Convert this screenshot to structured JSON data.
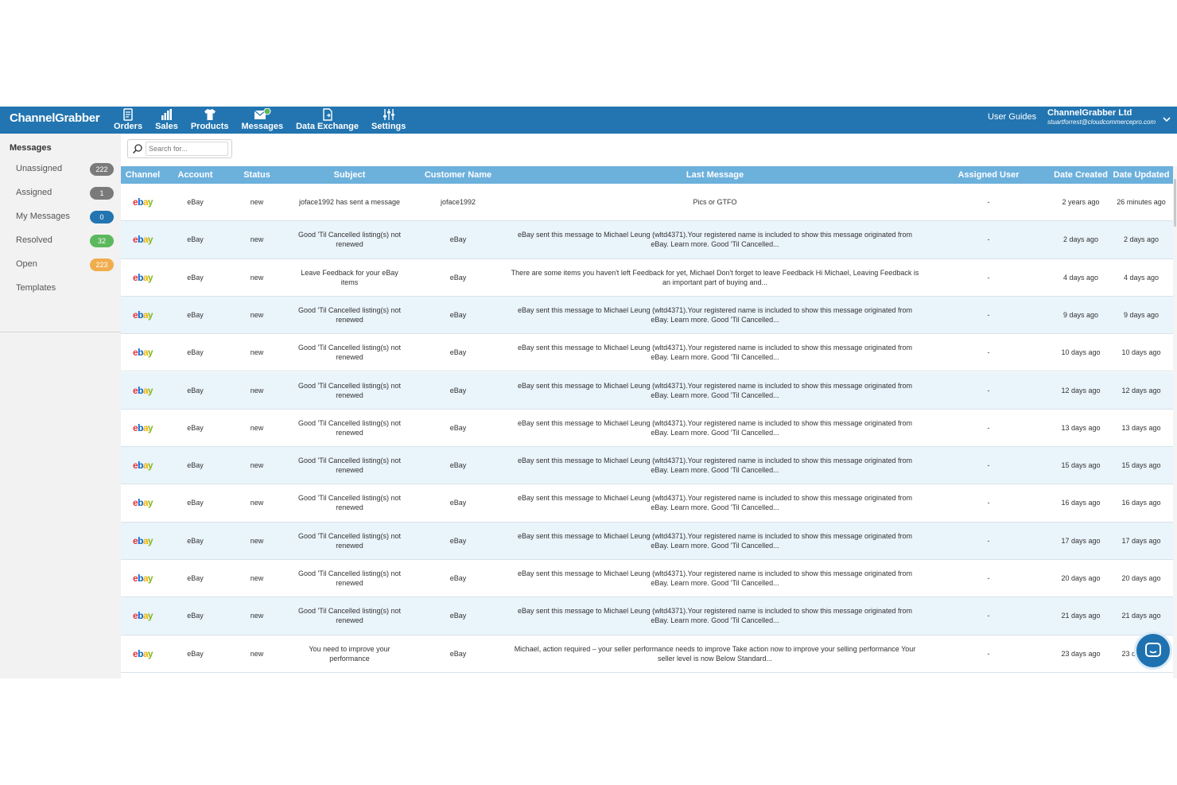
{
  "brand": {
    "logo": "ChannelGrabber",
    "colors": {
      "topbar": "#2275b0",
      "table_header": "#6cb0dc",
      "row_alt": "#eaf4fb"
    }
  },
  "nav": [
    {
      "label": "Orders",
      "icon": "orders-icon"
    },
    {
      "label": "Sales",
      "icon": "bar-chart-icon"
    },
    {
      "label": "Products",
      "icon": "shirt-icon"
    },
    {
      "label": "Messages",
      "icon": "envelope-icon"
    },
    {
      "label": "Data Exchange",
      "icon": "file-exchange-icon"
    },
    {
      "label": "Settings",
      "icon": "sliders-icon"
    }
  ],
  "header": {
    "user_guides": "User Guides",
    "account_name": "ChannelGrabber Ltd",
    "account_email": "stuartforrest@cloudcommercepro.com"
  },
  "sidebar": {
    "title": "Messages",
    "items": [
      {
        "label": "Unassigned",
        "count": "222",
        "badge_color": "#7a7a7a"
      },
      {
        "label": "Assigned",
        "count": "1",
        "badge_color": "#7a7a7a"
      },
      {
        "label": "My Messages",
        "count": "0",
        "badge_color": "#2275b0"
      },
      {
        "label": "Resolved",
        "count": "32",
        "badge_color": "#5cb85c"
      },
      {
        "label": "Open",
        "count": "223",
        "badge_color": "#f0ad4e"
      },
      {
        "label": "Templates",
        "count": ""
      }
    ]
  },
  "search": {
    "placeholder": "Search for..."
  },
  "table": {
    "columns": [
      "Channel",
      "Account",
      "Status",
      "Subject",
      "Customer Name",
      "Last Message",
      "Assigned User",
      "Date Created",
      "Date Updated"
    ],
    "rows": [
      {
        "channel": "ebay",
        "account": "eBay",
        "status": "new",
        "subject": "joface1992 has sent a message",
        "customer": "joface1992",
        "last_message": "Pics or GTFO",
        "assigned": "-",
        "created": "2 years ago",
        "updated": "26 minutes ago"
      },
      {
        "channel": "ebay",
        "account": "eBay",
        "status": "new",
        "subject": "Good 'Til Cancelled listing(s) not renewed",
        "customer": "eBay",
        "last_message": "eBay sent this message to Michael Leung (wltd4371).Your registered name is included to show this message originated from eBay. Learn more. Good 'Til Cancelled...",
        "assigned": "-",
        "created": "2 days ago",
        "updated": "2 days ago"
      },
      {
        "channel": "ebay",
        "account": "eBay",
        "status": "new",
        "subject": "Leave Feedback for your eBay items",
        "customer": "eBay",
        "last_message": "There are some items you haven't left Feedback for yet, Michael Don't forget to leave Feedback Hi Michael, Leaving Feedback is an important part of buying and...",
        "assigned": "-",
        "created": "4 days ago",
        "updated": "4 days ago"
      },
      {
        "channel": "ebay",
        "account": "eBay",
        "status": "new",
        "subject": "Good 'Til Cancelled listing(s) not renewed",
        "customer": "eBay",
        "last_message": "eBay sent this message to Michael Leung (wltd4371).Your registered name is included to show this message originated from eBay. Learn more. Good 'Til Cancelled...",
        "assigned": "-",
        "created": "9 days ago",
        "updated": "9 days ago"
      },
      {
        "channel": "ebay",
        "account": "eBay",
        "status": "new",
        "subject": "Good 'Til Cancelled listing(s) not renewed",
        "customer": "eBay",
        "last_message": "eBay sent this message to Michael Leung (wltd4371).Your registered name is included to show this message originated from eBay. Learn more. Good 'Til Cancelled...",
        "assigned": "-",
        "created": "10 days ago",
        "updated": "10 days ago"
      },
      {
        "channel": "ebay",
        "account": "eBay",
        "status": "new",
        "subject": "Good 'Til Cancelled listing(s) not renewed",
        "customer": "eBay",
        "last_message": "eBay sent this message to Michael Leung (wltd4371).Your registered name is included to show this message originated from eBay. Learn more. Good 'Til Cancelled...",
        "assigned": "-",
        "created": "12 days ago",
        "updated": "12 days ago"
      },
      {
        "channel": "ebay",
        "account": "eBay",
        "status": "new",
        "subject": "Good 'Til Cancelled listing(s) not renewed",
        "customer": "eBay",
        "last_message": "eBay sent this message to Michael Leung (wltd4371).Your registered name is included to show this message originated from eBay. Learn more. Good 'Til Cancelled...",
        "assigned": "-",
        "created": "13 days ago",
        "updated": "13 days ago"
      },
      {
        "channel": "ebay",
        "account": "eBay",
        "status": "new",
        "subject": "Good 'Til Cancelled listing(s) not renewed",
        "customer": "eBay",
        "last_message": "eBay sent this message to Michael Leung (wltd4371).Your registered name is included to show this message originated from eBay. Learn more. Good 'Til Cancelled...",
        "assigned": "-",
        "created": "15 days ago",
        "updated": "15 days ago"
      },
      {
        "channel": "ebay",
        "account": "eBay",
        "status": "new",
        "subject": "Good 'Til Cancelled listing(s) not renewed",
        "customer": "eBay",
        "last_message": "eBay sent this message to Michael Leung (wltd4371).Your registered name is included to show this message originated from eBay. Learn more. Good 'Til Cancelled...",
        "assigned": "-",
        "created": "16 days ago",
        "updated": "16 days ago"
      },
      {
        "channel": "ebay",
        "account": "eBay",
        "status": "new",
        "subject": "Good 'Til Cancelled listing(s) not renewed",
        "customer": "eBay",
        "last_message": "eBay sent this message to Michael Leung (wltd4371).Your registered name is included to show this message originated from eBay. Learn more. Good 'Til Cancelled...",
        "assigned": "-",
        "created": "17 days ago",
        "updated": "17 days ago"
      },
      {
        "channel": "ebay",
        "account": "eBay",
        "status": "new",
        "subject": "Good 'Til Cancelled listing(s) not renewed",
        "customer": "eBay",
        "last_message": "eBay sent this message to Michael Leung (wltd4371).Your registered name is included to show this message originated from eBay. Learn more. Good 'Til Cancelled...",
        "assigned": "-",
        "created": "20 days ago",
        "updated": "20 days ago"
      },
      {
        "channel": "ebay",
        "account": "eBay",
        "status": "new",
        "subject": "Good 'Til Cancelled listing(s) not renewed",
        "customer": "eBay",
        "last_message": "eBay sent this message to Michael Leung (wltd4371).Your registered name is included to show this message originated from eBay. Learn more. Good 'Til Cancelled...",
        "assigned": "-",
        "created": "21 days ago",
        "updated": "21 days ago"
      },
      {
        "channel": "ebay",
        "account": "eBay",
        "status": "new",
        "subject": "You need to improve your performance",
        "customer": "eBay",
        "last_message": "Michael, action required – your seller performance needs to improve Take action now to improve your selling performance Your seller level is now Below Standard...",
        "assigned": "-",
        "created": "23 days ago",
        "updated": "23 days ago"
      }
    ]
  }
}
